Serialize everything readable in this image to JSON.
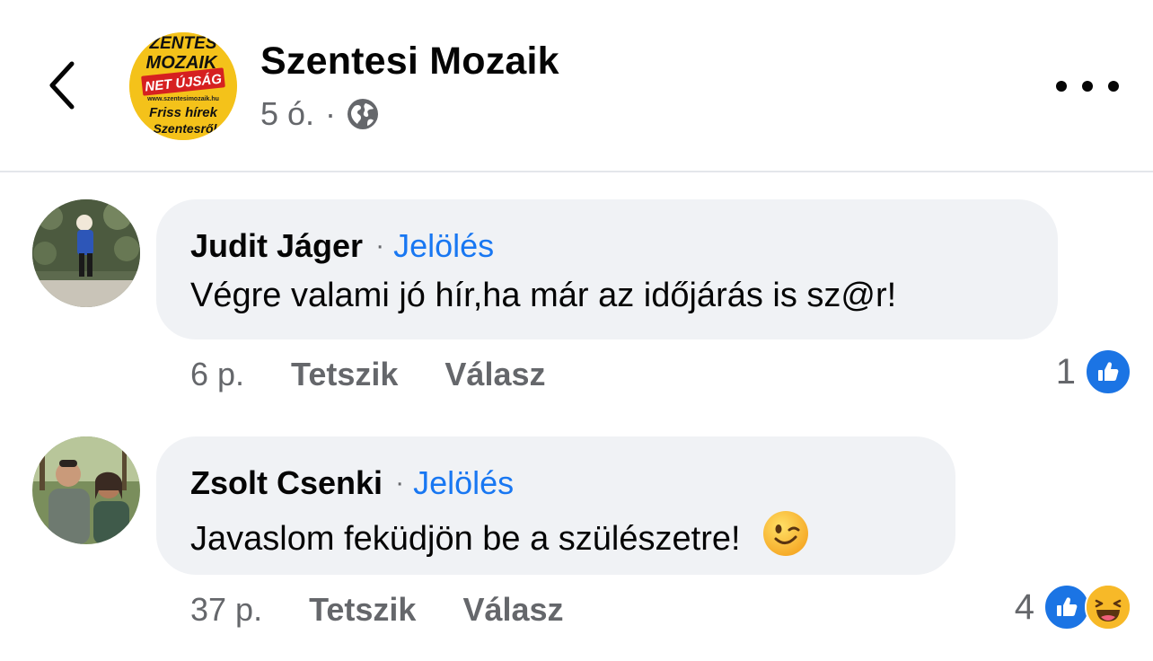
{
  "header": {
    "page_name": "Szentesi Mozaik",
    "post_time": "5 ó.",
    "separator": "·",
    "audience_icon": "globe-icon",
    "avatar_logo": {
      "line1": "ZENTES",
      "line2": "MOZAIK",
      "line3": "NET ÚJSÁG",
      "line4": "www.szentesimozaik.hu",
      "line5": "Friss hírek",
      "line6": "Szentesről"
    }
  },
  "comments": [
    {
      "author": "Judit Jáger",
      "separator": "·",
      "tag_label": "Jelölés",
      "text": "Végre valami jó hír,ha már az időjárás is sz@r!",
      "time": "6 p.",
      "like_label": "Tetszik",
      "reply_label": "Válasz",
      "reaction_count": "1",
      "reactions": [
        "like-icon"
      ]
    },
    {
      "author": "Zsolt Csenki",
      "separator": "·",
      "tag_label": "Jelölés",
      "text": "Javaslom feküdjön be a szülészetre!",
      "emoji": "winking-face-emoji",
      "time": "37 p.",
      "like_label": "Tetszik",
      "reply_label": "Válasz",
      "reaction_count": "4",
      "reactions": [
        "like-icon",
        "haha-icon"
      ]
    }
  ],
  "colors": {
    "link_blue": "#1877f2",
    "secondary_text": "#65676b",
    "bubble_bg": "#f0f2f5",
    "like_blue": "#1b74e4",
    "haha_yellow": "#f7b928"
  }
}
